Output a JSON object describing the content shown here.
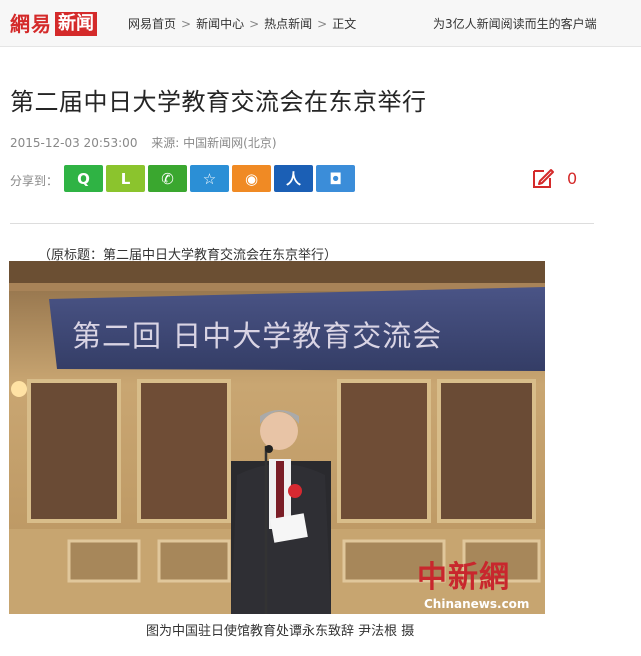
{
  "header": {
    "logo_part1": "網易",
    "logo_part2": "新闻",
    "breadcrumbs": [
      "网易首页",
      "新闻中心",
      "热点新闻",
      "正文"
    ],
    "separator": ">",
    "slogan": "为3亿人新闻阅读而生的客户端"
  },
  "article": {
    "title": "第二届中日大学教育交流会在东京举行",
    "datetime": "2015-12-03 20:53:00",
    "source": "来源: 中国新闻网(北京)",
    "share_label": "分享到：",
    "share_buttons": [
      {
        "icon": "qzone-icon",
        "glyph": "Q",
        "color": "#2fb344"
      },
      {
        "icon": "laiwang-icon",
        "glyph": "L",
        "color": "#8bc42d"
      },
      {
        "icon": "wechat-icon",
        "glyph": "✆",
        "color": "#3aa72f"
      },
      {
        "icon": "favorite-star-icon",
        "glyph": "☆",
        "color": "#2b8fd6"
      },
      {
        "icon": "weibo-icon",
        "glyph": "◉",
        "color": "#f08a24"
      },
      {
        "icon": "renren-icon",
        "glyph": "人",
        "color": "#1b5fb5"
      },
      {
        "icon": "yixin-icon",
        "glyph": "◘",
        "color": "#3b8dd9"
      }
    ],
    "comment_icon": "edit-comment-icon",
    "comment_count": "0",
    "original_title": "（原标题：第二届中日大学教育交流会在东京举行）",
    "photo": {
      "banner_text": "第二回  日中大学教育交流会",
      "watermark_cn": "中新網",
      "watermark_en": "Chinanews.com"
    },
    "caption": "图为中国驻日使馆教育处谭永东致辞   尹法根   摄"
  },
  "colors": {
    "brand_red": "#d42a2a",
    "banner_blue": "#3f4976"
  }
}
